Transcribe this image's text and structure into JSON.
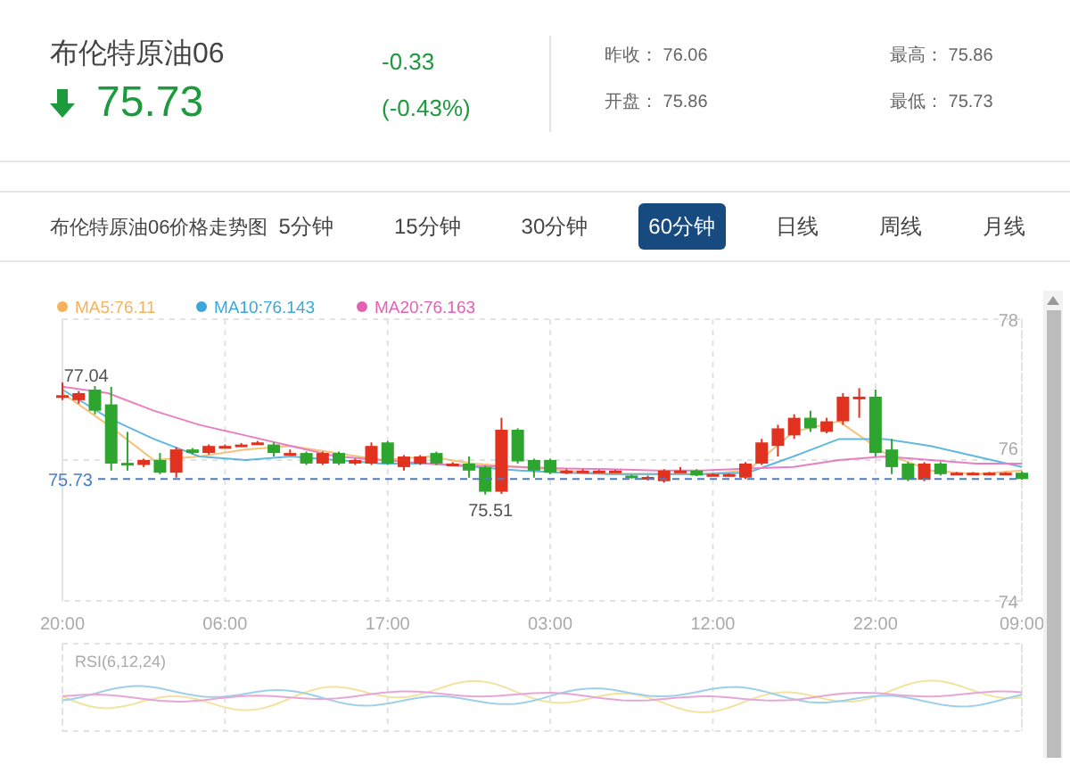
{
  "quote": {
    "name": "布伦特原油06",
    "falling": true,
    "price": "75.73",
    "change": "-0.33",
    "change_percent": "(-0.43%)",
    "stats": [
      {
        "label": "昨收：",
        "value": "76.06"
      },
      {
        "label": "最高：",
        "value": "75.86"
      },
      {
        "label": "开盘：",
        "value": "75.86"
      },
      {
        "label": "最低：",
        "value": "75.73"
      }
    ]
  },
  "chart_title": "布伦特原油06价格走势图",
  "tabs": [
    {
      "label": "5分钟",
      "selected": false
    },
    {
      "label": "15分钟",
      "selected": false
    },
    {
      "label": "30分钟",
      "selected": false
    },
    {
      "label": "60分钟",
      "selected": true
    },
    {
      "label": "日线",
      "selected": false
    },
    {
      "label": "周线",
      "selected": false
    },
    {
      "label": "月线",
      "selected": false
    }
  ],
  "chart": {
    "legend": [
      {
        "label": "MA5:76.11",
        "color": "#f5b25a"
      },
      {
        "label": "MA10:76.143",
        "color": "#3aa7d8"
      },
      {
        "label": "MA20:76.163",
        "color": "#e360b5"
      }
    ],
    "y_labels": [
      "78",
      "76",
      "74"
    ],
    "x_labels": [
      "20:00",
      "06:00",
      "17:00",
      "03:00",
      "12:00",
      "22:00",
      "09:00"
    ],
    "high_label": "77.04",
    "low_label": "75.51",
    "last_price_label": "75.73"
  },
  "rsi": {
    "label": "RSI(6,12,24)"
  }
}
